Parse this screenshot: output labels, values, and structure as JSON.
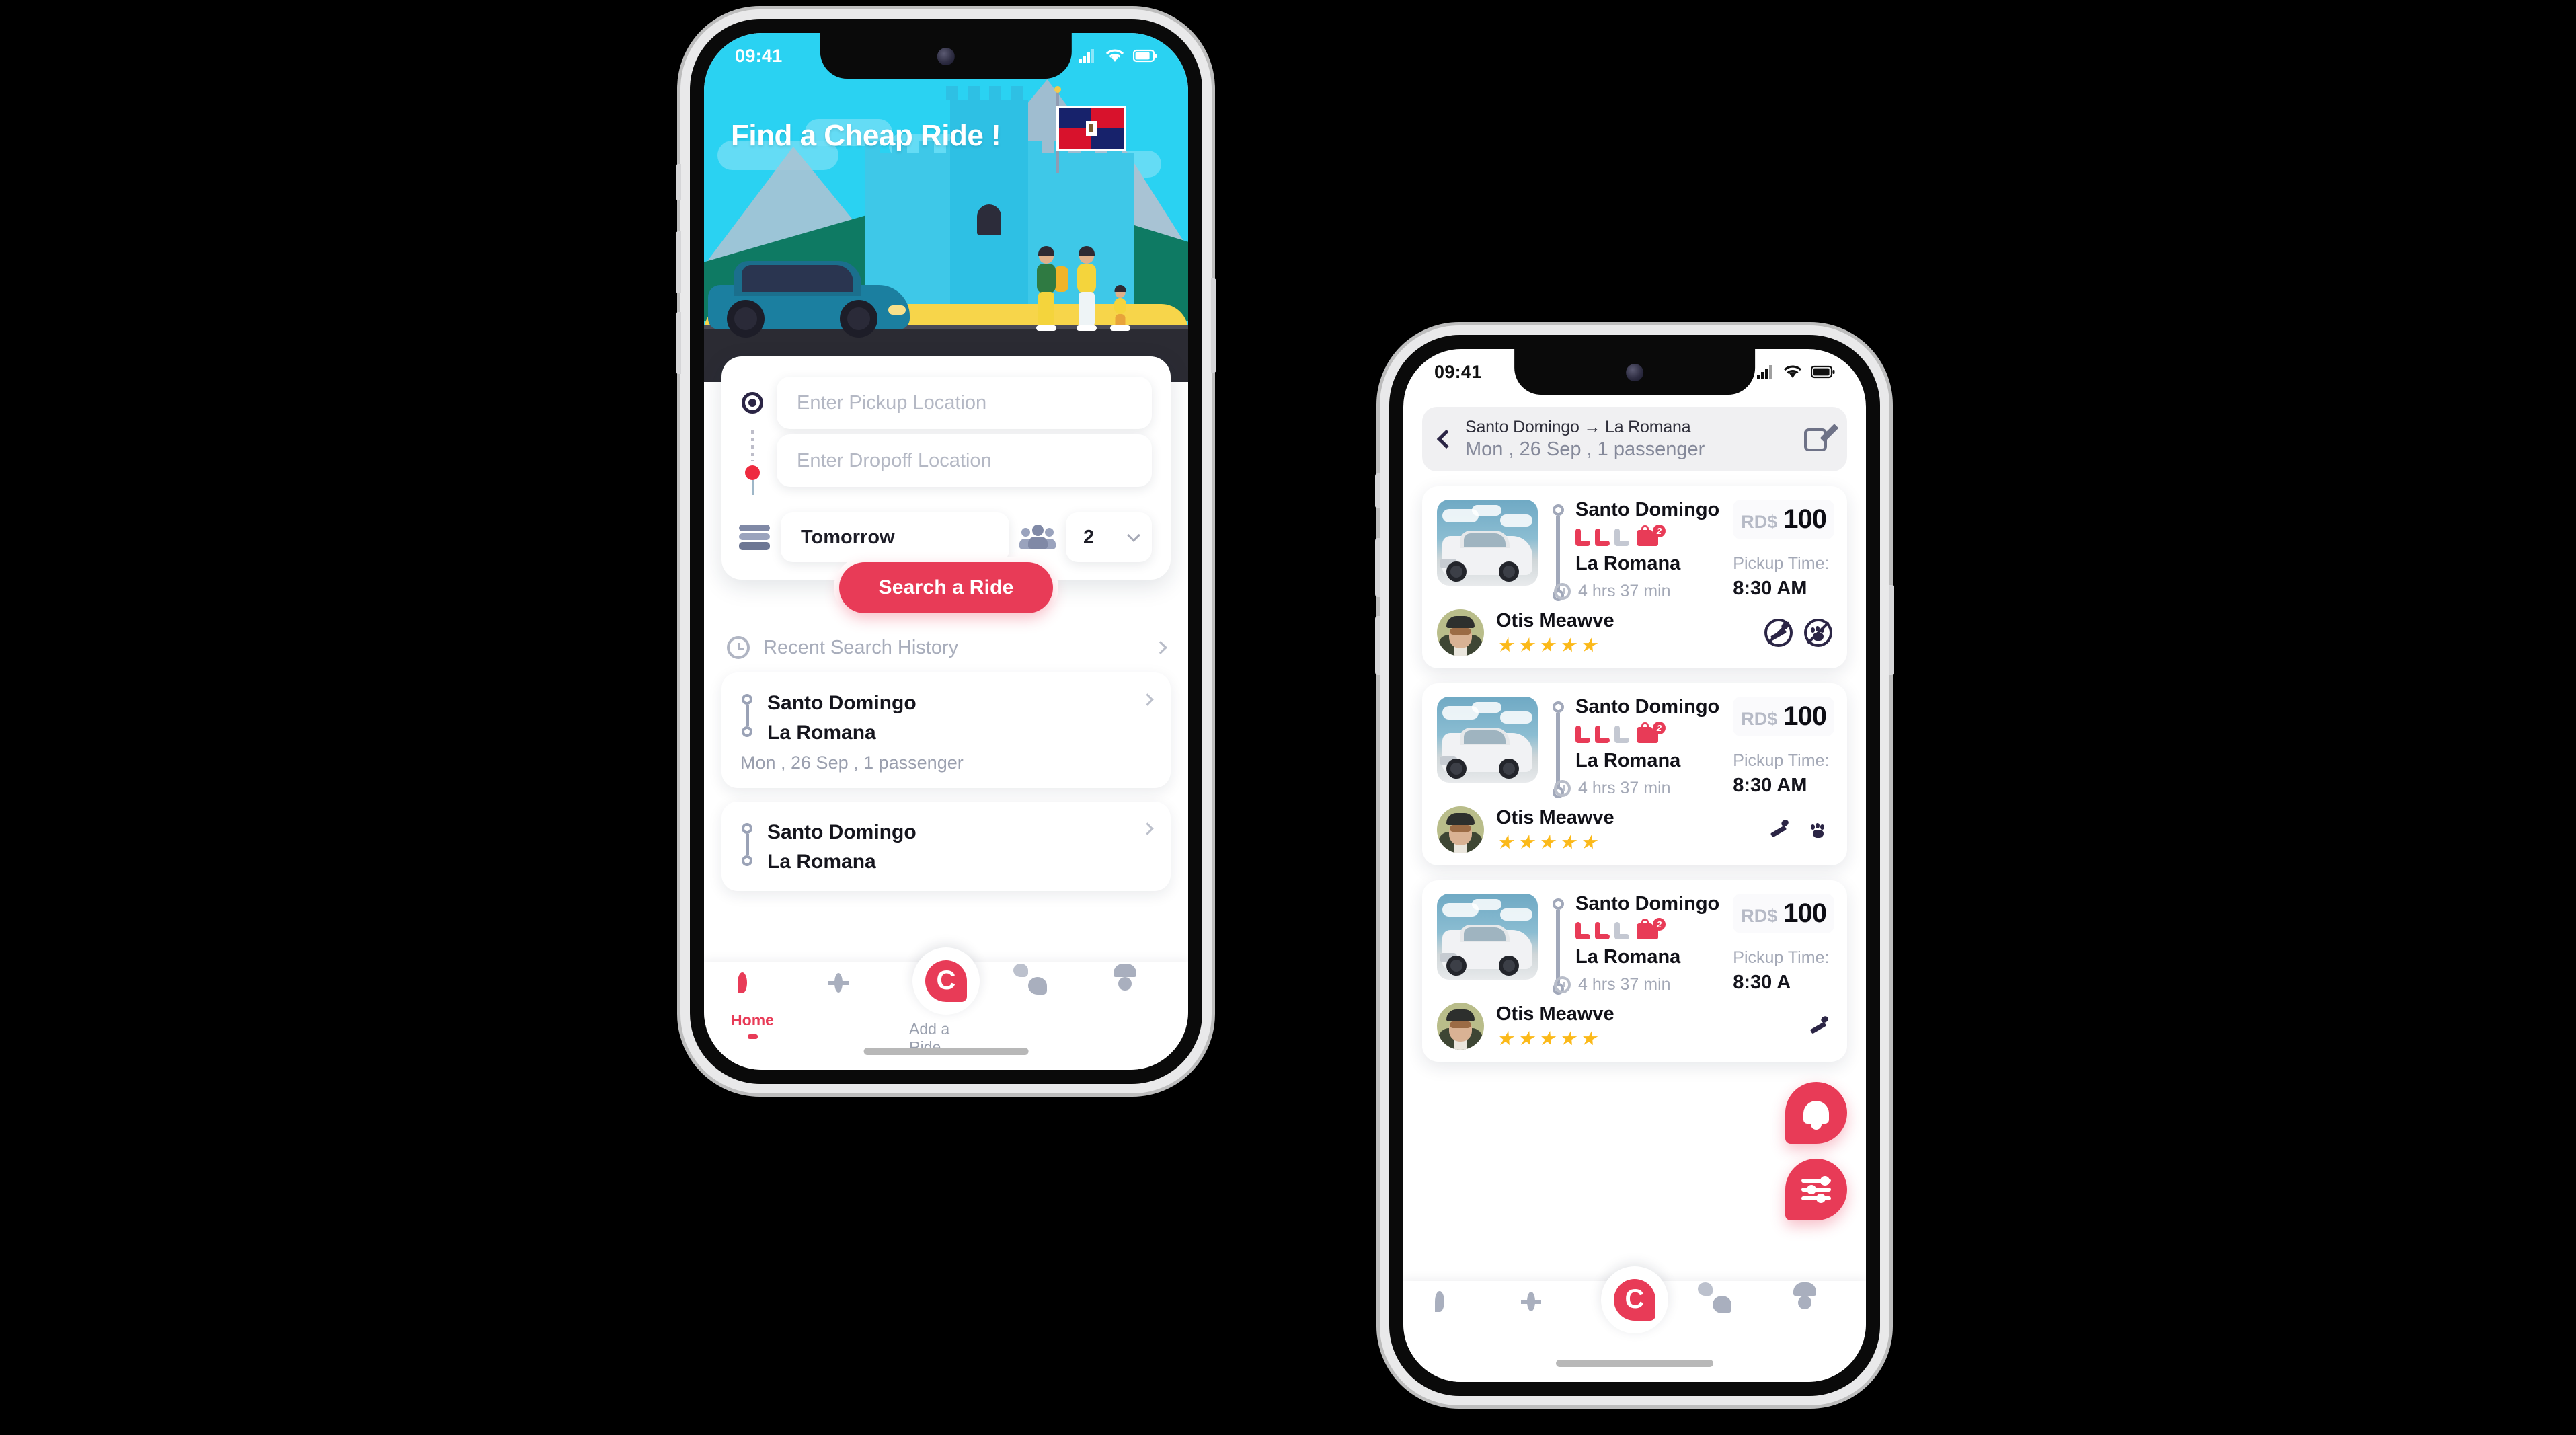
{
  "brand": {
    "red": "#e83b57",
    "dark": "#2b2545",
    "sky": "#2ad2f2",
    "logo_letter": "C"
  },
  "phone1": {
    "status": {
      "time": "09:41"
    },
    "hero": {
      "title": "Find a Cheap Ride !",
      "flag": "dominican-republic-flag"
    },
    "search": {
      "pickup_placeholder": "Enter Pickup Location",
      "pickup_value": "",
      "dropoff_placeholder": "Enter Dropoff Location",
      "dropoff_value": "",
      "date_value": "Tomorrow",
      "passengers_value": "2",
      "submit_label": "Search a Ride"
    },
    "history": {
      "heading": "Recent Search History",
      "items": [
        {
          "from": "Santo Domingo",
          "to": "La Romana",
          "meta": "Mon , 26 Sep , 1 passenger"
        },
        {
          "from": "Santo Domingo",
          "to": "La Romana",
          "meta": ""
        }
      ]
    },
    "nav": {
      "items": [
        {
          "label": "Home",
          "icon": "location-pin-icon",
          "active": true
        },
        {
          "label": "",
          "icon": "steering-wheel-icon",
          "active": false
        },
        {
          "label": "Add a Ride",
          "icon": "logo-c-icon",
          "active": false
        },
        {
          "label": "",
          "icon": "chat-bubbles-icon",
          "active": false
        },
        {
          "label": "",
          "icon": "user-profile-icon",
          "active": false
        }
      ]
    }
  },
  "phone2": {
    "status": {
      "time": "09:41"
    },
    "header": {
      "route": "Santo Domingo → La Romana",
      "subtitle": "Mon , 26 Sep , 1 passenger",
      "back_icon": "back-chevron-icon",
      "edit_icon": "edit-pencil-icon"
    },
    "rides": [
      {
        "from": "Santo Domingo",
        "to": "La Romana",
        "duration": "4 hrs 37 min",
        "currency": "RD$",
        "price": "100",
        "pickup_label": "Pickup Time:",
        "pickup_time": "8:30 AM",
        "driver": "Otis Meawve",
        "stars": 5,
        "seats_available": 2,
        "seats_taken": 1,
        "luggage_count": "2",
        "amenities": [
          "no-smoking-icon",
          "no-pets-icon"
        ]
      },
      {
        "from": "Santo Domingo",
        "to": "La Romana",
        "duration": "4 hrs 37 min",
        "currency": "RD$",
        "price": "100",
        "pickup_label": "Pickup Time:",
        "pickup_time": "8:30 AM",
        "driver": "Otis Meawve",
        "stars": 5,
        "seats_available": 2,
        "seats_taken": 1,
        "luggage_count": "2",
        "amenities": [
          "smoking-allowed-icon",
          "pets-allowed-icon"
        ]
      },
      {
        "from": "Santo Domingo",
        "to": "La Romana",
        "duration": "4 hrs 37 min",
        "currency": "RD$",
        "price": "100",
        "pickup_label": "Pickup Time:",
        "pickup_time": "8:30 A",
        "driver": "Otis Meawve",
        "stars": 5,
        "seats_available": 2,
        "seats_taken": 1,
        "luggage_count": "2",
        "amenities": [
          "smoking-allowed-icon"
        ]
      }
    ],
    "fabs": [
      {
        "icon": "notification-bell-icon"
      },
      {
        "icon": "filter-sliders-icon"
      }
    ],
    "nav": {
      "items": [
        {
          "label": "",
          "icon": "location-pin-icon",
          "active": false
        },
        {
          "label": "",
          "icon": "steering-wheel-icon",
          "active": false
        },
        {
          "label": "",
          "icon": "logo-c-icon",
          "active": false
        },
        {
          "label": "",
          "icon": "chat-bubbles-icon",
          "active": false
        },
        {
          "label": "",
          "icon": "user-profile-icon",
          "active": false
        }
      ]
    }
  }
}
